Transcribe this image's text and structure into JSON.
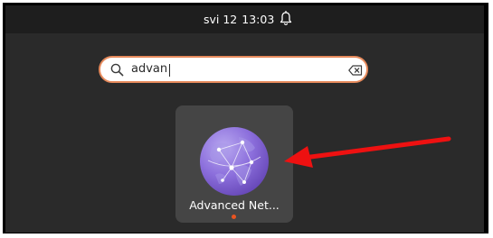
{
  "topbar": {
    "date": "svi 12",
    "time": "13:03",
    "notification_icon": "bell-icon"
  },
  "search": {
    "value": "advan",
    "icon": "search-icon",
    "clear_icon": "clear-text-icon",
    "focus_color": "#e68a5c"
  },
  "results": [
    {
      "label": "Advanced Net...",
      "icon": "network-globe-icon",
      "running": true,
      "running_indicator_color": "#e95420"
    }
  ],
  "annotation": {
    "arrow_color": "#ee1111"
  },
  "colors": {
    "background": "#2a2a2a",
    "topbar": "#1e1e1e",
    "tile": "#454545"
  }
}
